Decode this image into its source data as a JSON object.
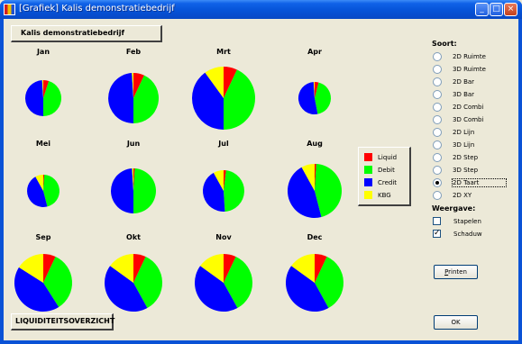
{
  "window": {
    "title": "[Grafiek] Kalis demonstratiebedrijf",
    "minimize_glyph": "_",
    "maximize_glyph": "□",
    "close_glyph": "×"
  },
  "company_label": "Kalis demonstratiebedrijf",
  "report_button": "LIQUIDITEITSOVERZICHT",
  "legend": [
    {
      "name": "Liquid",
      "color": "#ff0000"
    },
    {
      "name": "Debit",
      "color": "#00ff00"
    },
    {
      "name": "Credit",
      "color": "#0000ff"
    },
    {
      "name": "KBG",
      "color": "#ffff00"
    }
  ],
  "soort": {
    "heading": "Soort:",
    "options": [
      "2D Ruimte",
      "3D Ruimte",
      "2D Bar",
      "3D Bar",
      "2D Combi",
      "3D Combi",
      "2D Lijn",
      "3D Lijn",
      "2D Step",
      "3D Step",
      "2D Taart",
      "2D XY"
    ],
    "selected_index": 10
  },
  "weergave": {
    "heading": "Weergave:",
    "options": [
      {
        "label": "Stapelen",
        "checked": false
      },
      {
        "label": "Schaduw",
        "checked": true
      }
    ]
  },
  "buttons": {
    "print": "Printen",
    "ok": "OK"
  },
  "chart_data": {
    "type": "pie",
    "series_names": [
      "Liquid",
      "Debit",
      "Credit",
      "KBG"
    ],
    "colors": [
      "#ff0000",
      "#00ff00",
      "#0000ff",
      "#ffff00"
    ],
    "pies": [
      {
        "label": "Jan",
        "values": [
          0.05,
          0.45,
          0.49,
          0.01
        ]
      },
      {
        "label": "Feb",
        "values": [
          0.07,
          0.43,
          0.49,
          0.01
        ]
      },
      {
        "label": "Mrt",
        "values": [
          0.07,
          0.43,
          0.4,
          0.1
        ]
      },
      {
        "label": "Apr",
        "values": [
          0.04,
          0.43,
          0.52,
          0.01
        ]
      },
      {
        "label": "Mei",
        "values": [
          0.01,
          0.45,
          0.46,
          0.08
        ]
      },
      {
        "label": "Jun",
        "values": [
          0.01,
          0.49,
          0.49,
          0.01
        ]
      },
      {
        "label": "Jul",
        "values": [
          0.02,
          0.47,
          0.43,
          0.08
        ]
      },
      {
        "label": "Aug",
        "values": [
          0.01,
          0.45,
          0.46,
          0.08
        ]
      },
      {
        "label": "Sep",
        "values": [
          0.07,
          0.34,
          0.43,
          0.16
        ]
      },
      {
        "label": "Okt",
        "values": [
          0.07,
          0.35,
          0.43,
          0.15
        ]
      },
      {
        "label": "Nov",
        "values": [
          0.07,
          0.35,
          0.43,
          0.15
        ]
      },
      {
        "label": "Dec",
        "values": [
          0.07,
          0.35,
          0.43,
          0.15
        ]
      }
    ]
  }
}
